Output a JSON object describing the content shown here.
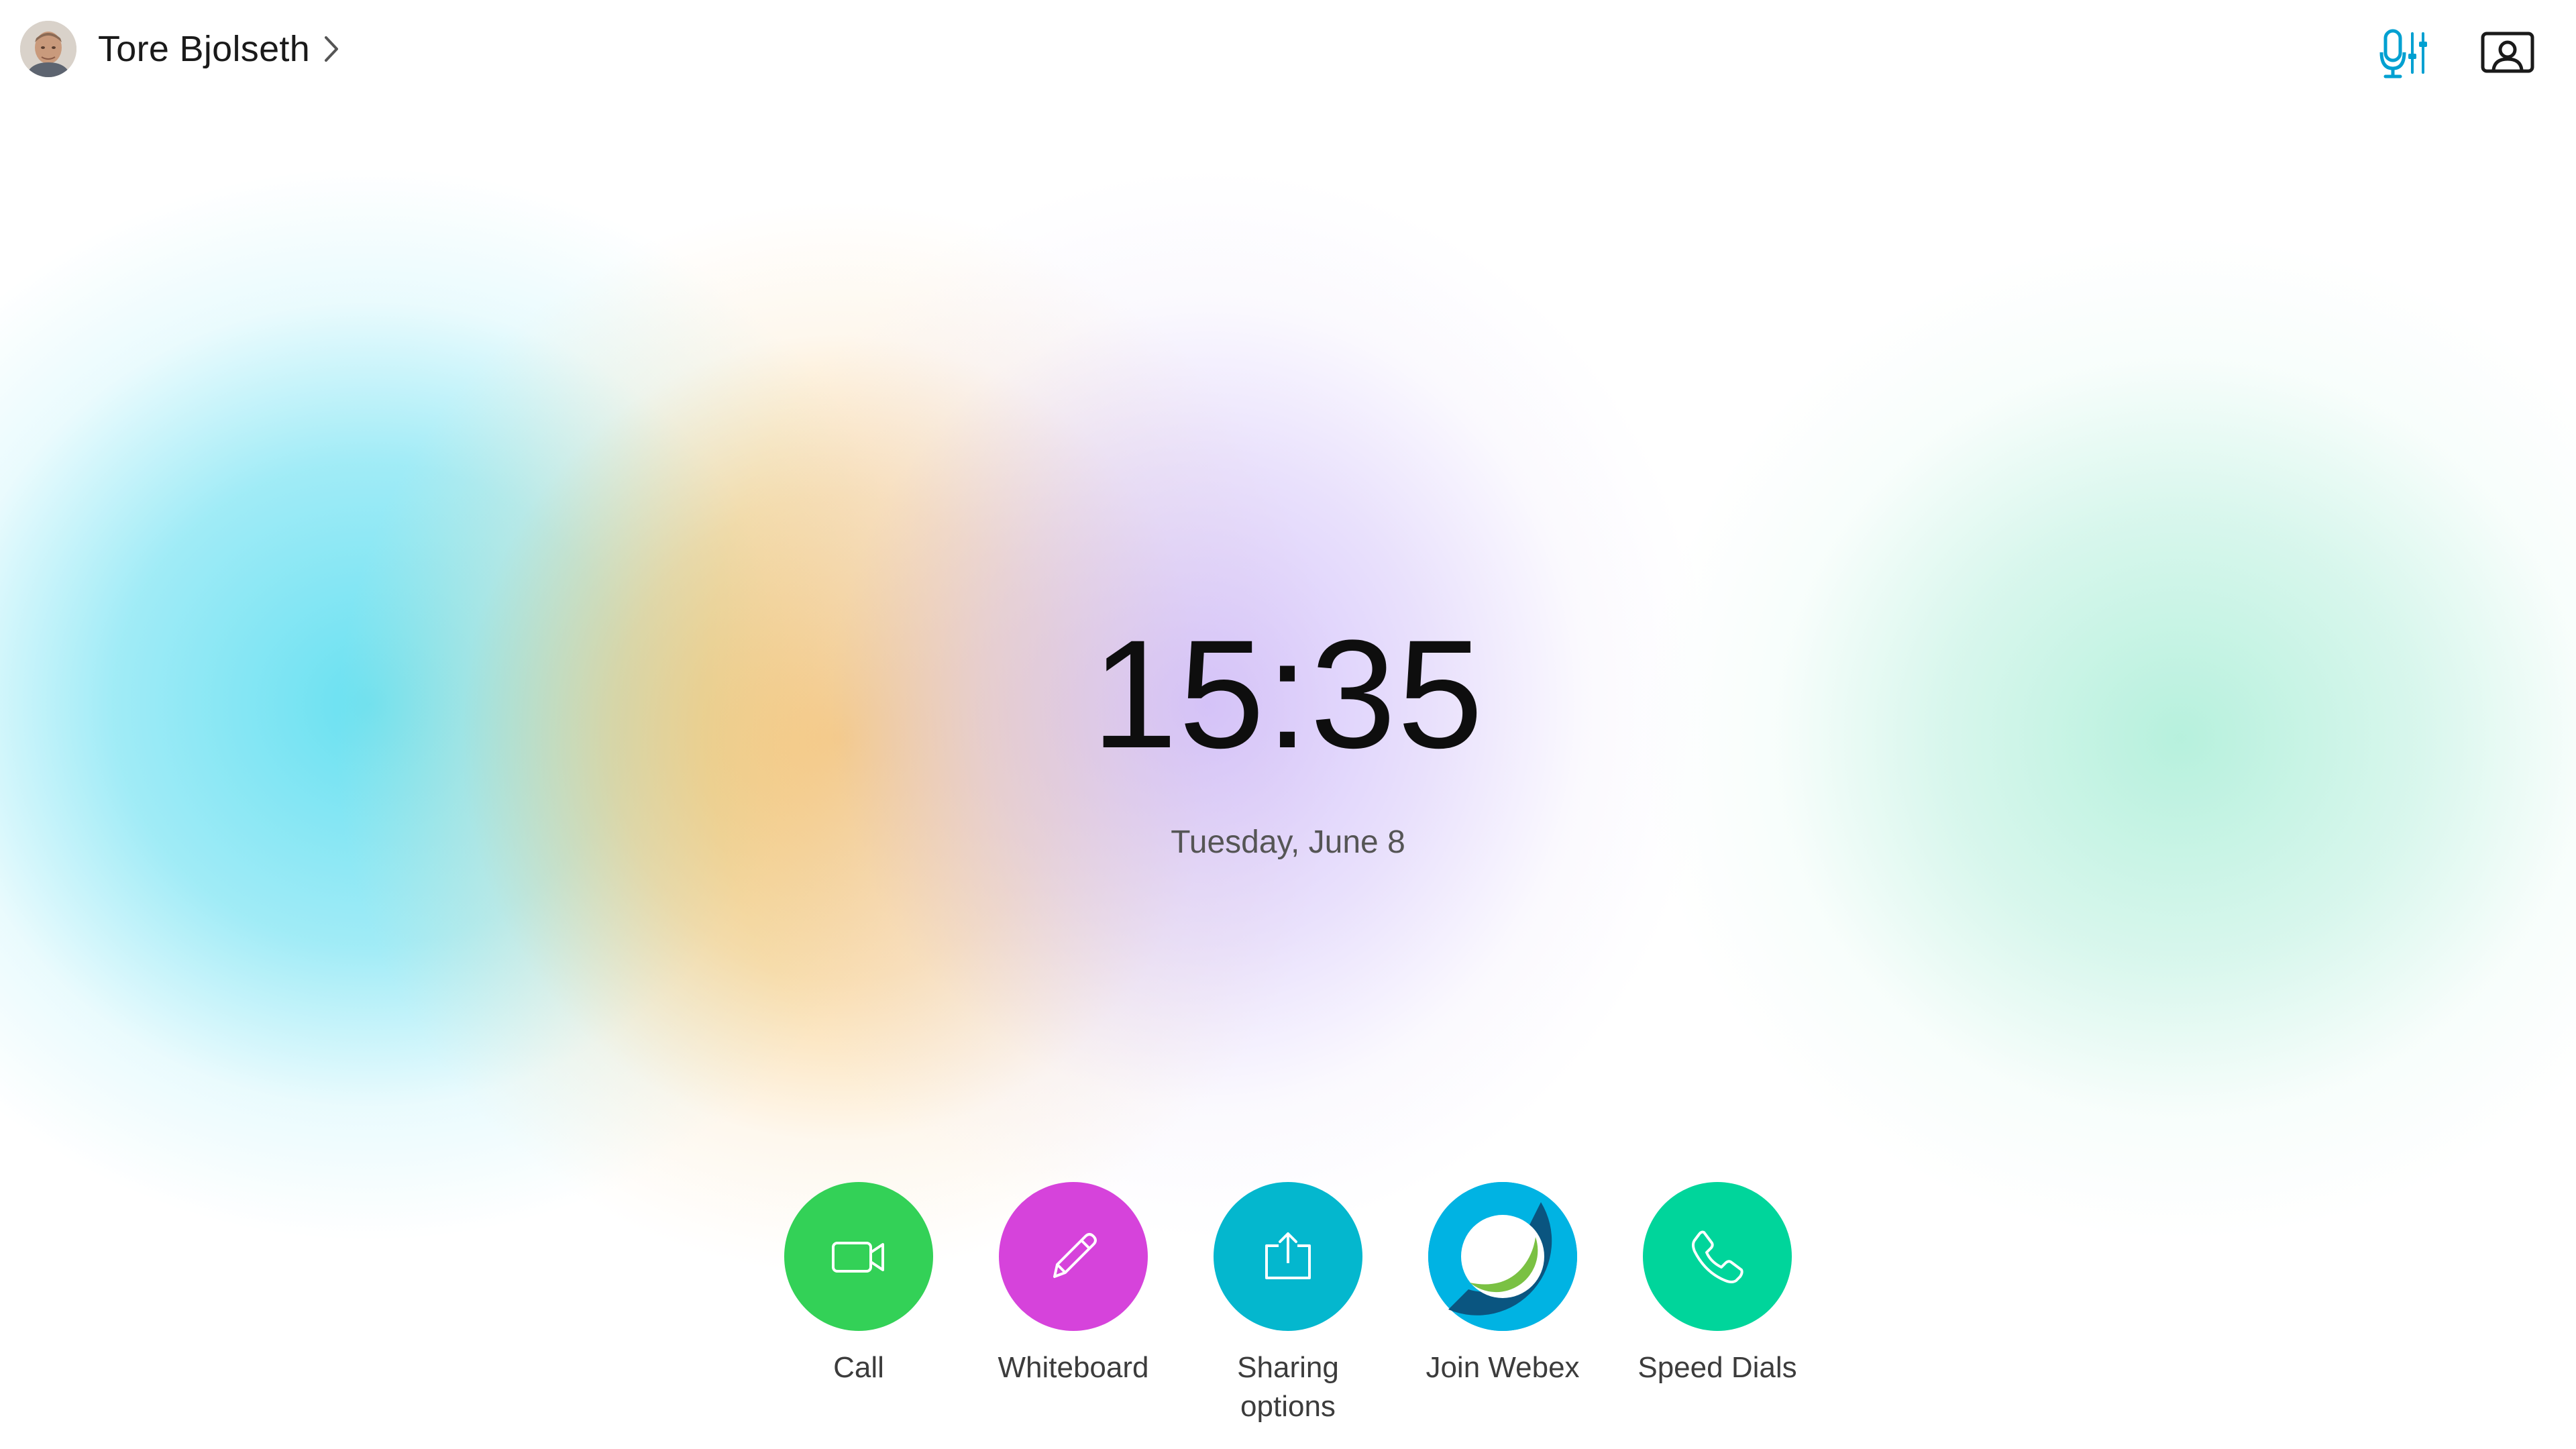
{
  "user": {
    "name": "Tore Bjolseth"
  },
  "header": {
    "mic_icon_color": "#00a0d1",
    "icon_color": "#1a1a1a"
  },
  "clock": {
    "time": "15:35",
    "date": "Tuesday, June 8"
  },
  "dock": {
    "call": {
      "label": "Call",
      "color": "#33d157",
      "icon": "video-camera-icon"
    },
    "whiteboard": {
      "label": "Whiteboard",
      "color": "#d643db",
      "icon": "pencil-icon"
    },
    "sharing": {
      "label": "Sharing\noptions",
      "color": "#04b7ce",
      "icon": "share-screen-icon"
    },
    "webex": {
      "label": "Join Webex",
      "color": "#00b3e3",
      "icon": "webex-logo-icon"
    },
    "speed_dials": {
      "label": "Speed Dials",
      "color": "#00d59b",
      "icon": "phone-handset-icon"
    }
  },
  "background": {
    "blob_colors": [
      "#5cdef0",
      "#f7be5f",
      "#cdb9fa",
      "#aaeed7"
    ]
  }
}
